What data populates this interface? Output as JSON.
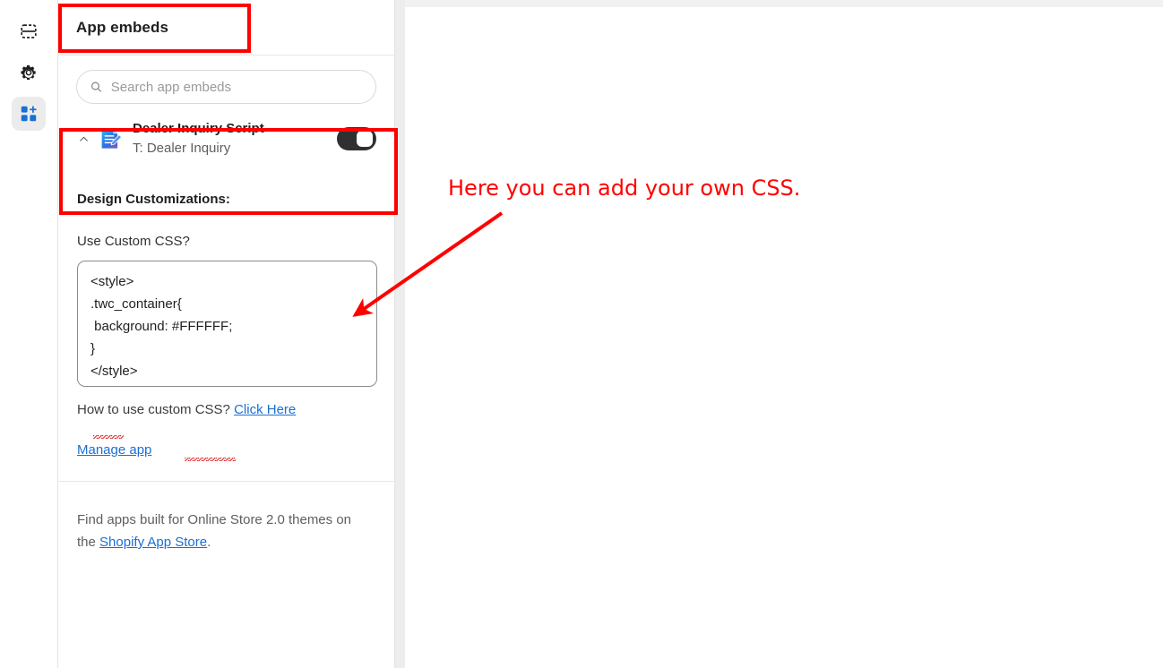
{
  "sidebar": {
    "items": [
      {
        "name": "sections-icon",
        "label": "Sections"
      },
      {
        "name": "theme-settings-icon",
        "label": "Theme settings"
      },
      {
        "name": "app-embeds-icon",
        "label": "App embeds",
        "active": true
      }
    ]
  },
  "panel": {
    "title": "App embeds",
    "search": {
      "placeholder": "Search app embeds",
      "value": ""
    },
    "embed": {
      "title": "Dealer Inquiry Script",
      "subtitle": "T: Dealer Inquiry",
      "toggle_state": "on",
      "collapse_label": "Collapse"
    },
    "design": {
      "heading": "Design Customizations:",
      "css_question": "Use Custom CSS?",
      "css_value": "<style>\n.twc_container{\n background: #FFFFFF;\n}\n</style>",
      "help_prefix": "How to use custom CSS? ",
      "help_link": "Click Here",
      "manage_link": "Manage app"
    },
    "footer": {
      "text_before": "Find apps built for Online Store 2.0 themes on the ",
      "link": "Shopify App Store",
      "text_after": "."
    }
  },
  "annotation": {
    "text": "Here you can add your own CSS.",
    "color": "#ff0000"
  },
  "colors": {
    "accent_link": "#1a6fd4",
    "toggle_on": "#303030",
    "annotation_red": "#ff0000",
    "panel_border": "#e3e3e3",
    "app_icon_blue": "#2a7de1"
  }
}
